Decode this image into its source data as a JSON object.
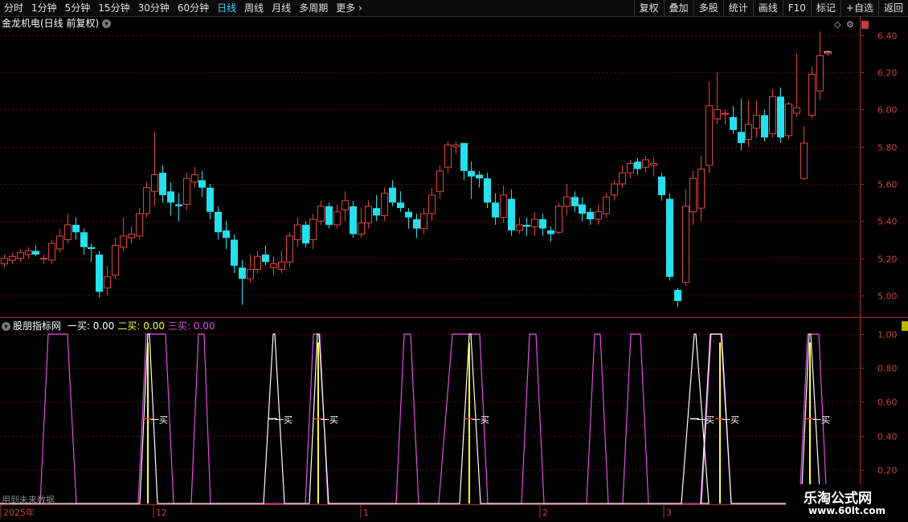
{
  "toolbar": {
    "timeframes": [
      "分时",
      "1分钟",
      "5分钟",
      "15分钟",
      "30分钟",
      "60分钟",
      "日线",
      "周线",
      "月线",
      "多周期",
      "更多"
    ],
    "active_timeframe": "日线",
    "right_buttons": [
      "复权",
      "叠加",
      "多股",
      "统计",
      "画线",
      "F10",
      "标记",
      "+自选",
      "返回"
    ]
  },
  "chart_header": {
    "name": "金龙机电(日线 前复权)"
  },
  "indicator_header": {
    "name": "股朋指标网",
    "items": [
      {
        "label": "一买: 0.00",
        "color": "#ffffff"
      },
      {
        "label": "二买: 0.00",
        "color": "#ffff33"
      },
      {
        "label": "三买: 0.00",
        "color": "#e050e0"
      }
    ]
  },
  "footer_note": "用到未来数据",
  "watermark": {
    "line1": "乐淘公式网",
    "line2": "www.60lt.com"
  },
  "colors": {
    "up": "#e0463c",
    "down": "#26e0ee",
    "grid": "#5a0f0f",
    "axis": "#a83030",
    "magenta": "#e050e0",
    "yellow": "#ffff33"
  },
  "chart_data": [
    {
      "type": "candlestick",
      "y_ticks": [
        "6.40",
        "6.20",
        "6.00",
        "5.80",
        "5.60",
        "5.40",
        "5.20",
        "5.00"
      ],
      "ylim": [
        4.9,
        6.45
      ],
      "grid": true,
      "candles": [
        [
          5.17,
          5.2,
          5.15,
          5.22
        ],
        [
          5.19,
          5.21,
          5.17,
          5.23
        ],
        [
          5.2,
          5.23,
          5.18,
          5.25
        ],
        [
          5.22,
          5.24,
          5.2,
          5.26
        ],
        [
          5.24,
          5.22,
          5.21,
          5.27
        ],
        [
          5.2,
          5.2,
          5.17,
          5.22
        ],
        [
          5.19,
          5.28,
          5.17,
          5.3
        ],
        [
          5.25,
          5.32,
          5.23,
          5.36
        ],
        [
          5.3,
          5.38,
          5.28,
          5.44
        ],
        [
          5.38,
          5.34,
          5.3,
          5.42
        ],
        [
          5.34,
          5.26,
          5.22,
          5.36
        ],
        [
          5.26,
          5.25,
          5.18,
          5.28
        ],
        [
          5.22,
          5.02,
          4.99,
          5.24
        ],
        [
          5.04,
          5.1,
          5.0,
          5.16
        ],
        [
          5.11,
          5.27,
          5.09,
          5.31
        ],
        [
          5.26,
          5.32,
          5.24,
          5.42
        ],
        [
          5.31,
          5.33,
          5.28,
          5.37
        ],
        [
          5.32,
          5.44,
          5.3,
          5.47
        ],
        [
          5.44,
          5.58,
          5.42,
          5.61
        ],
        [
          5.56,
          5.65,
          5.48,
          5.88
        ],
        [
          5.66,
          5.54,
          5.5,
          5.7
        ],
        [
          5.56,
          5.5,
          5.43,
          5.61
        ],
        [
          5.49,
          5.48,
          5.4,
          5.55
        ],
        [
          5.49,
          5.63,
          5.46,
          5.66
        ],
        [
          5.61,
          5.65,
          5.58,
          5.69
        ],
        [
          5.62,
          5.58,
          5.53,
          5.67
        ],
        [
          5.58,
          5.45,
          5.41,
          5.6
        ],
        [
          5.45,
          5.34,
          5.3,
          5.48
        ],
        [
          5.35,
          5.31,
          5.25,
          5.4
        ],
        [
          5.3,
          5.16,
          5.12,
          5.33
        ],
        [
          5.15,
          5.09,
          4.95,
          5.19
        ],
        [
          5.09,
          5.14,
          5.07,
          5.22
        ],
        [
          5.14,
          5.21,
          5.12,
          5.24
        ],
        [
          5.22,
          5.18,
          5.16,
          5.27
        ],
        [
          5.15,
          5.17,
          5.11,
          5.21
        ],
        [
          5.14,
          5.18,
          5.12,
          5.24
        ],
        [
          5.18,
          5.32,
          5.15,
          5.34
        ],
        [
          5.3,
          5.38,
          5.26,
          5.42
        ],
        [
          5.38,
          5.28,
          5.26,
          5.4
        ],
        [
          5.3,
          5.41,
          5.25,
          5.44
        ],
        [
          5.4,
          5.48,
          5.38,
          5.51
        ],
        [
          5.48,
          5.38,
          5.36,
          5.5
        ],
        [
          5.38,
          5.45,
          5.36,
          5.49
        ],
        [
          5.46,
          5.51,
          5.4,
          5.56
        ],
        [
          5.48,
          5.33,
          5.31,
          5.51
        ],
        [
          5.33,
          5.39,
          5.31,
          5.47
        ],
        [
          5.39,
          5.48,
          5.36,
          5.51
        ],
        [
          5.47,
          5.43,
          5.4,
          5.54
        ],
        [
          5.43,
          5.55,
          5.4,
          5.58
        ],
        [
          5.58,
          5.5,
          5.48,
          5.62
        ],
        [
          5.5,
          5.47,
          5.45,
          5.56
        ],
        [
          5.45,
          5.42,
          5.36,
          5.47
        ],
        [
          5.41,
          5.36,
          5.31,
          5.44
        ],
        [
          5.36,
          5.44,
          5.33,
          5.47
        ],
        [
          5.44,
          5.54,
          5.4,
          5.58
        ],
        [
          5.56,
          5.67,
          5.52,
          5.7
        ],
        [
          5.69,
          5.81,
          5.66,
          5.83
        ],
        [
          5.8,
          5.81,
          5.76,
          5.83
        ],
        [
          5.82,
          5.67,
          5.62,
          5.82
        ],
        [
          5.67,
          5.64,
          5.52,
          5.72
        ],
        [
          5.65,
          5.63,
          5.58,
          5.67
        ],
        [
          5.63,
          5.5,
          5.47,
          5.66
        ],
        [
          5.5,
          5.42,
          5.38,
          5.55
        ],
        [
          5.42,
          5.54,
          5.39,
          5.59
        ],
        [
          5.52,
          5.35,
          5.32,
          5.57
        ],
        [
          5.35,
          5.38,
          5.33,
          5.42
        ],
        [
          5.38,
          5.37,
          5.32,
          5.42
        ],
        [
          5.37,
          5.41,
          5.32,
          5.45
        ],
        [
          5.41,
          5.36,
          5.32,
          5.44
        ],
        [
          5.35,
          5.33,
          5.29,
          5.37
        ],
        [
          5.34,
          5.48,
          5.33,
          5.5
        ],
        [
          5.48,
          5.53,
          5.43,
          5.6
        ],
        [
          5.53,
          5.48,
          5.45,
          5.56
        ],
        [
          5.49,
          5.44,
          5.4,
          5.53
        ],
        [
          5.45,
          5.41,
          5.38,
          5.47
        ],
        [
          5.41,
          5.45,
          5.38,
          5.49
        ],
        [
          5.44,
          5.53,
          5.42,
          5.55
        ],
        [
          5.54,
          5.6,
          5.51,
          5.62
        ],
        [
          5.6,
          5.66,
          5.58,
          5.7
        ],
        [
          5.66,
          5.71,
          5.63,
          5.73
        ],
        [
          5.72,
          5.68,
          5.65,
          5.74
        ],
        [
          5.69,
          5.73,
          5.66,
          5.75
        ],
        [
          5.7,
          5.71,
          5.64,
          5.74
        ],
        [
          5.64,
          5.54,
          5.51,
          5.66
        ],
        [
          5.52,
          5.1,
          5.08,
          5.55
        ],
        [
          5.03,
          4.97,
          4.94,
          5.04
        ],
        [
          5.07,
          5.48,
          5.05,
          5.57
        ],
        [
          5.45,
          5.63,
          5.38,
          5.67
        ],
        [
          5.47,
          5.68,
          5.4,
          5.75
        ],
        [
          5.7,
          6.02,
          5.66,
          6.15
        ],
        [
          5.95,
          6.0,
          5.92,
          6.2
        ],
        [
          5.98,
          5.98,
          5.92,
          6.0
        ],
        [
          5.96,
          5.89,
          5.87,
          6.02
        ],
        [
          5.88,
          5.82,
          5.78,
          6.06
        ],
        [
          5.84,
          5.92,
          5.8,
          6.05
        ],
        [
          5.9,
          5.97,
          5.85,
          6.05
        ],
        [
          5.97,
          5.85,
          5.83,
          6.0
        ],
        [
          5.87,
          6.07,
          5.85,
          6.11
        ],
        [
          6.07,
          5.85,
          5.82,
          6.12
        ],
        [
          5.86,
          6.03,
          5.84,
          6.04
        ],
        [
          5.98,
          6.01,
          5.96,
          6.3
        ],
        [
          5.63,
          5.82,
          5.62,
          5.91
        ],
        [
          5.97,
          6.19,
          5.95,
          6.23
        ],
        [
          6.1,
          6.29,
          6.05,
          6.42
        ],
        [
          6.3,
          6.31,
          6.29,
          6.32
        ]
      ]
    },
    {
      "type": "line",
      "y_ticks": [
        "1.00",
        "0.80",
        "0.60",
        "0.40",
        "0.20"
      ],
      "ylim": [
        0,
        1.02
      ],
      "series": [
        {
          "name": "三买",
          "color": "#e050e0",
          "pulses": [
            [
              50,
              60,
              84,
              95
            ],
            [
              172,
              182,
              206,
              216
            ],
            [
              238,
              247,
              254,
              262
            ],
            [
              380,
              390,
              398,
              408
            ],
            [
              493,
              503,
              511,
              521
            ],
            [
              546,
              563,
              597,
              607
            ],
            [
              649,
              659,
              667,
              677
            ],
            [
              730,
              740,
              747,
              757
            ],
            [
              775,
              785,
              797,
              807
            ],
            [
              873,
              885,
              897,
              910
            ],
            [
              995,
              1005,
              1019,
              1029
            ]
          ]
        },
        {
          "name": "一买",
          "color": "#ffffff",
          "pulses": [
            [
              174,
              184,
              186,
              196
            ],
            [
              328,
              340,
              342,
              354
            ],
            [
              385,
              395,
              397,
              409
            ],
            [
              572,
              584,
              586,
              598
            ],
            [
              848,
              864,
              866,
              882
            ],
            [
              872,
              884,
              898,
              910
            ],
            [
              997,
              1007,
              1009,
              1021
            ]
          ]
        },
        {
          "name": "二买",
          "color": "#ffff33",
          "spikes": [
            184,
            396,
            584,
            896,
            1008
          ]
        }
      ],
      "annotations": [
        {
          "text": "一买",
          "x": 182,
          "y": 0.5,
          "color": "#ffffff",
          "mark": "#ff3030"
        },
        {
          "text": "一买",
          "x": 337,
          "y": 0.5,
          "color": "#ffffff",
          "mark": "#ffffff"
        },
        {
          "text": "一买",
          "x": 394,
          "y": 0.5,
          "color": "#ffffff",
          "mark": "#ff3030"
        },
        {
          "text": "一买",
          "x": 582,
          "y": 0.5,
          "color": "#ffffff",
          "mark": "#ff3030"
        },
        {
          "text": "一买",
          "x": 862,
          "y": 0.5,
          "color": "#ffffff",
          "mark": "#ffffff"
        },
        {
          "text": "一买",
          "x": 893,
          "y": 0.5,
          "color": "#ffffff",
          "mark": "#ff3030"
        },
        {
          "text": "一买",
          "x": 1006,
          "y": 0.5,
          "color": "#ffffff",
          "mark": "#ff3030"
        }
      ],
      "x_labels": [
        {
          "text": "2025年",
          "x": 4
        },
        {
          "text": "12",
          "x": 194
        },
        {
          "text": "1",
          "x": 452
        },
        {
          "text": "2",
          "x": 675
        },
        {
          "text": "3",
          "x": 829
        }
      ]
    }
  ]
}
